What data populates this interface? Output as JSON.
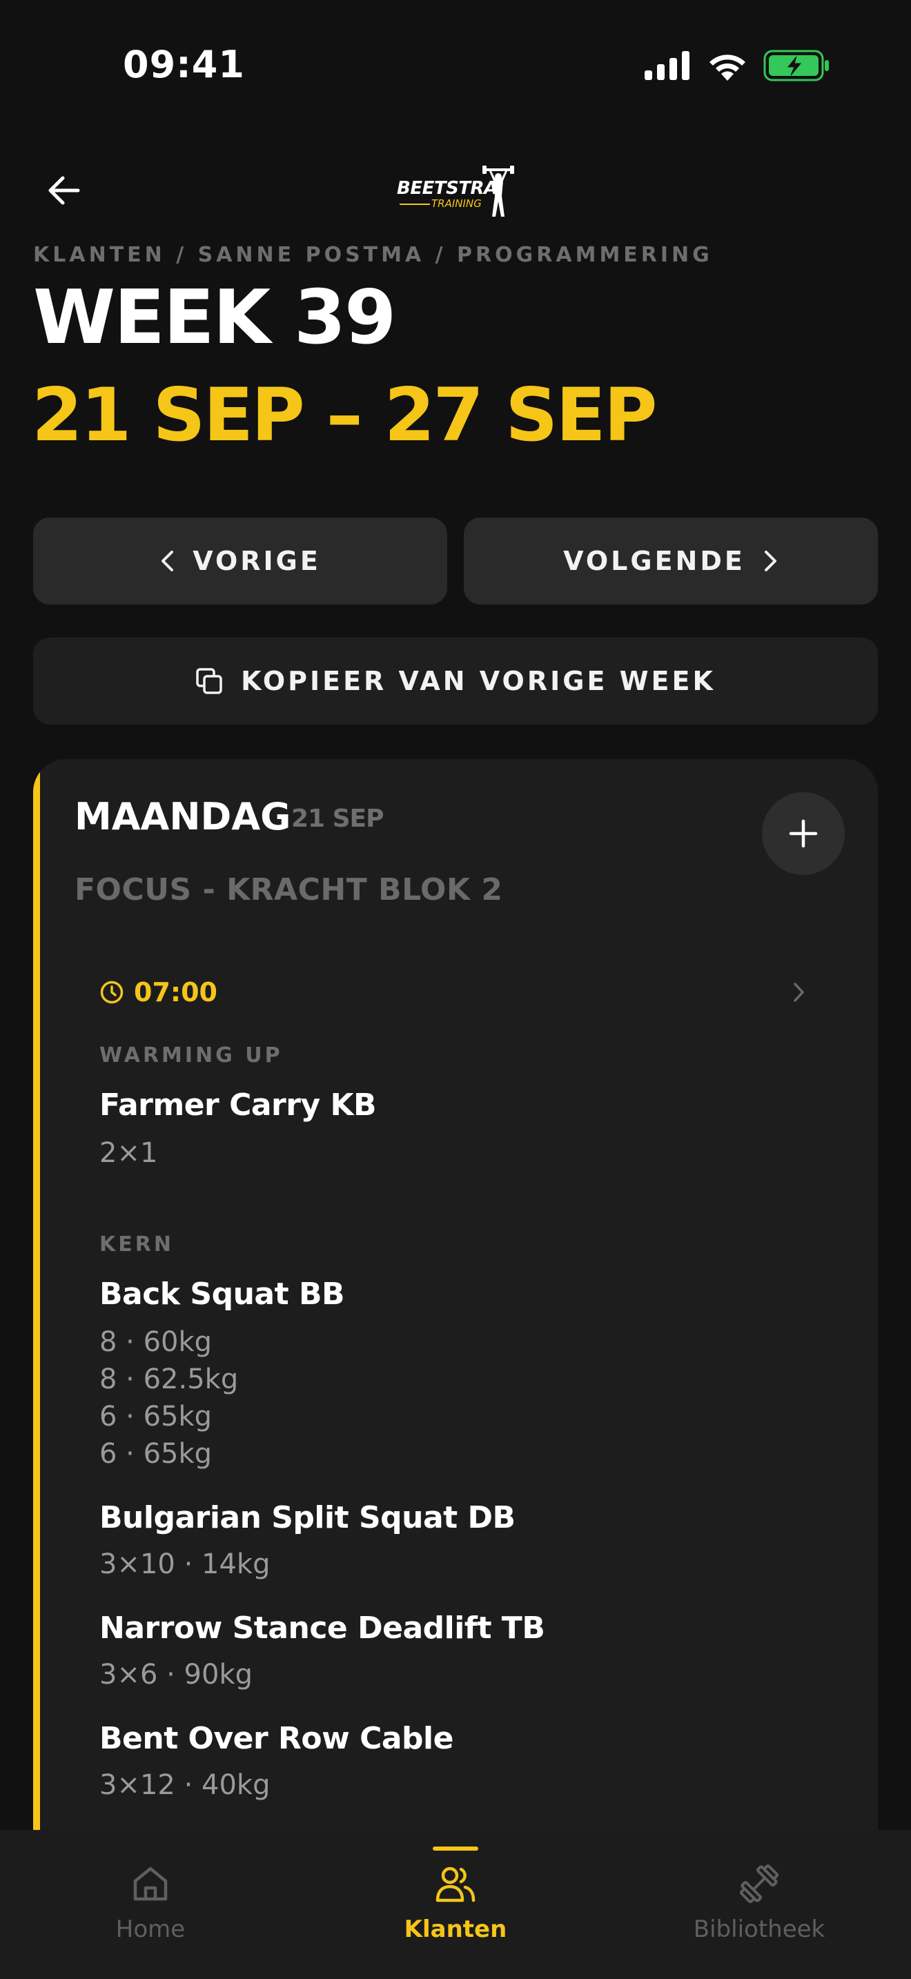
{
  "status_bar": {
    "time": "09:41"
  },
  "header": {
    "logo_text": "BEETSTRA",
    "logo_sub": "TRAINING",
    "breadcrumb": "KLANTEN / SANNE POSTMA / PROGRAMMERING",
    "title": "WEEK 39",
    "date_range": "21 SEP – 27 SEP"
  },
  "actions": {
    "prev_label": "VORIGE",
    "next_label": "VOLGENDE",
    "copy_label": "KOPIEER VAN VORIGE WEEK"
  },
  "day": {
    "name": "MAANDAG",
    "date": "21 SEP",
    "focus": "FOCUS - KRACHT BLOK 2",
    "session_time": "07:00",
    "sections": [
      {
        "label": "WARMING UP",
        "exercises": [
          {
            "name": "Farmer Carry KB",
            "details": [
              "2×1"
            ]
          }
        ]
      },
      {
        "label": "KERN",
        "exercises": [
          {
            "name": "Back Squat BB",
            "details": [
              "8 · 60kg",
              "8 · 62.5kg",
              "6 · 65kg",
              "6 · 65kg"
            ]
          },
          {
            "name": "Bulgarian Split Squat DB",
            "details": [
              "3×10 · 14kg"
            ]
          },
          {
            "name": "Narrow Stance Deadlift TB",
            "details": [
              "3×6 · 90kg"
            ]
          },
          {
            "name": "Bent Over Row Cable",
            "details": [
              "3×12 · 40kg"
            ]
          }
        ]
      }
    ]
  },
  "tabs": [
    {
      "label": "Home",
      "icon": "home-icon",
      "active": false
    },
    {
      "label": "Klanten",
      "icon": "users-icon",
      "active": true
    },
    {
      "label": "Bibliotheek",
      "icon": "dumbbell-icon",
      "active": false
    }
  ],
  "colors": {
    "accent": "#f5c518",
    "background": "#111111",
    "card": "#1d1d1d",
    "battery": "#34c759"
  }
}
